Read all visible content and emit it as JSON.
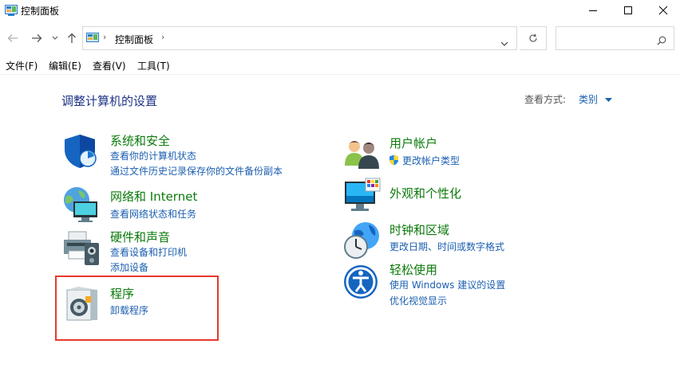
{
  "window": {
    "title": "控制面板"
  },
  "address": {
    "breadcrumb": "控制面板",
    "search_placeholder": ""
  },
  "menu": {
    "items": [
      "文件(F)",
      "编辑(E)",
      "查看(V)",
      "工具(T)"
    ]
  },
  "main": {
    "heading": "调整计算机的设置",
    "view_by_label": "查看方式:",
    "view_by_value": "类别",
    "categories_left": [
      {
        "title": "系统和安全",
        "links": [
          "查看你的计算机状态",
          "通过文件历史记录保存你的文件备份副本"
        ]
      },
      {
        "title": "网络和 Internet",
        "links": [
          "查看网络状态和任务"
        ]
      },
      {
        "title": "硬件和声音",
        "links": [
          "查看设备和打印机",
          "添加设备"
        ]
      },
      {
        "title": "程序",
        "links": [
          "卸载程序"
        ]
      }
    ],
    "categories_right": [
      {
        "title": "用户帐户",
        "links": [
          "更改帐户类型"
        ]
      },
      {
        "title": "外观和个性化",
        "links": []
      },
      {
        "title": "时钟和区域",
        "links": [
          "更改日期、时间或数字格式"
        ]
      },
      {
        "title": "轻松使用",
        "links": [
          "使用 Windows 建议的设置",
          "优化视觉显示"
        ]
      }
    ]
  },
  "colors": {
    "category_title": "#0b7a0b",
    "link": "#1c5fb0",
    "heading": "#1e3287",
    "highlight_border": "#e8392d"
  }
}
